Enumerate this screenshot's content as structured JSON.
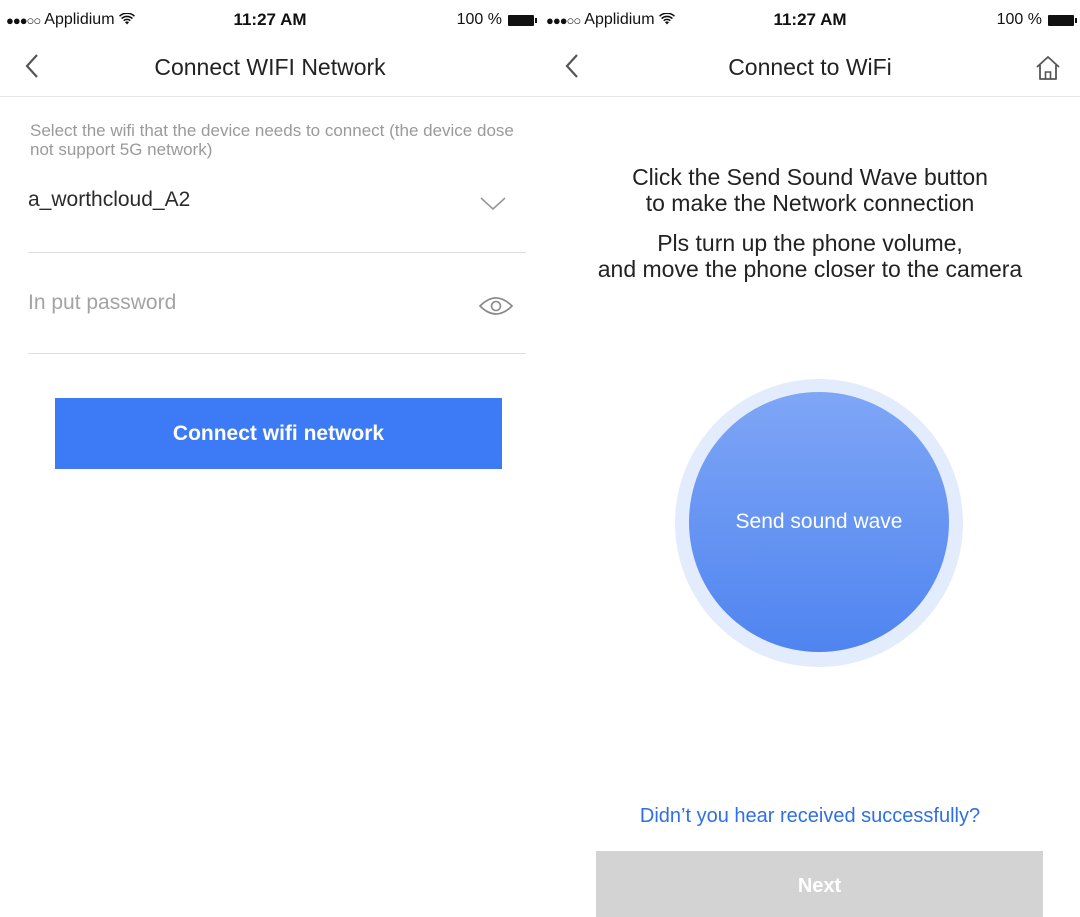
{
  "status_bar": {
    "carrier": "Applidium",
    "signal": "●●●○○",
    "time": "11:27 AM",
    "battery": "100 %"
  },
  "left_screen": {
    "title": "Connect WIFI Network",
    "hint": "Select the wifi that the device needs to connect (the device dose not support 5G network)",
    "ssid": "a_worthcloud_A2",
    "password_placeholder": "In put password",
    "connect_label": "Connect wifi network"
  },
  "right_screen": {
    "title": "Connect to WiFi",
    "instruction_1": "Click the Send Sound Wave button\nto make the Network connection",
    "instruction_2": "Pls turn up the phone volume,\nand move the phone closer to the camera",
    "wave_button_label": "Send sound wave",
    "help_link": "Didn’t you hear received successfully?",
    "next_label": "Next"
  },
  "colors": {
    "primary": "#3d7bf6",
    "link": "#2f6fe6",
    "disabled": "#d3d3d3"
  },
  "icons": [
    "back-arrow-icon",
    "home-icon",
    "chevron-down-icon",
    "eye-icon",
    "wifi-icon",
    "battery-icon"
  ]
}
